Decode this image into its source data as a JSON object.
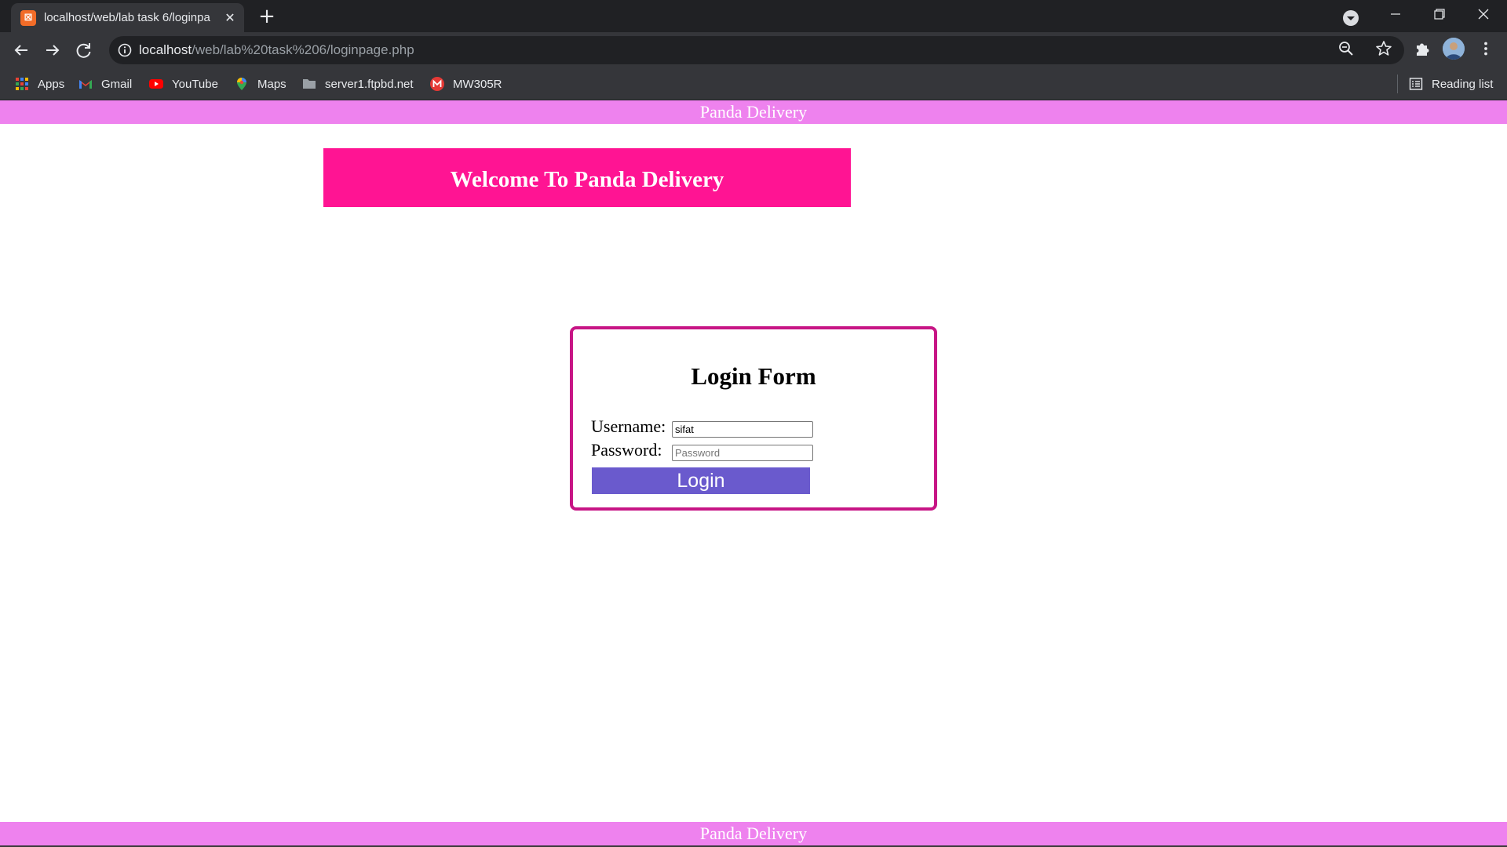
{
  "browser": {
    "tab_title": "localhost/web/lab task 6/loginpa",
    "url_host": "localhost",
    "url_path": "/web/lab%20task%206/loginpage.php",
    "bookmarks": [
      "Apps",
      "Gmail",
      "YouTube",
      "Maps",
      "server1.ftpbd.net",
      "MW305R"
    ],
    "reading_list": "Reading list"
  },
  "page": {
    "top_bar": "Panda Delivery",
    "welcome": "Welcome To Panda Delivery",
    "login_form": {
      "title": "Login Form",
      "username_label": "Username:",
      "username_value": "sifat",
      "password_label": "Password:",
      "password_placeholder": "Password",
      "login_button": "Login"
    },
    "bottom_bar": "Panda Delivery"
  },
  "colors": {
    "bar": "#ee82ee",
    "banner": "#ff1493",
    "form_border": "#c71585",
    "button": "#6a5acd"
  }
}
